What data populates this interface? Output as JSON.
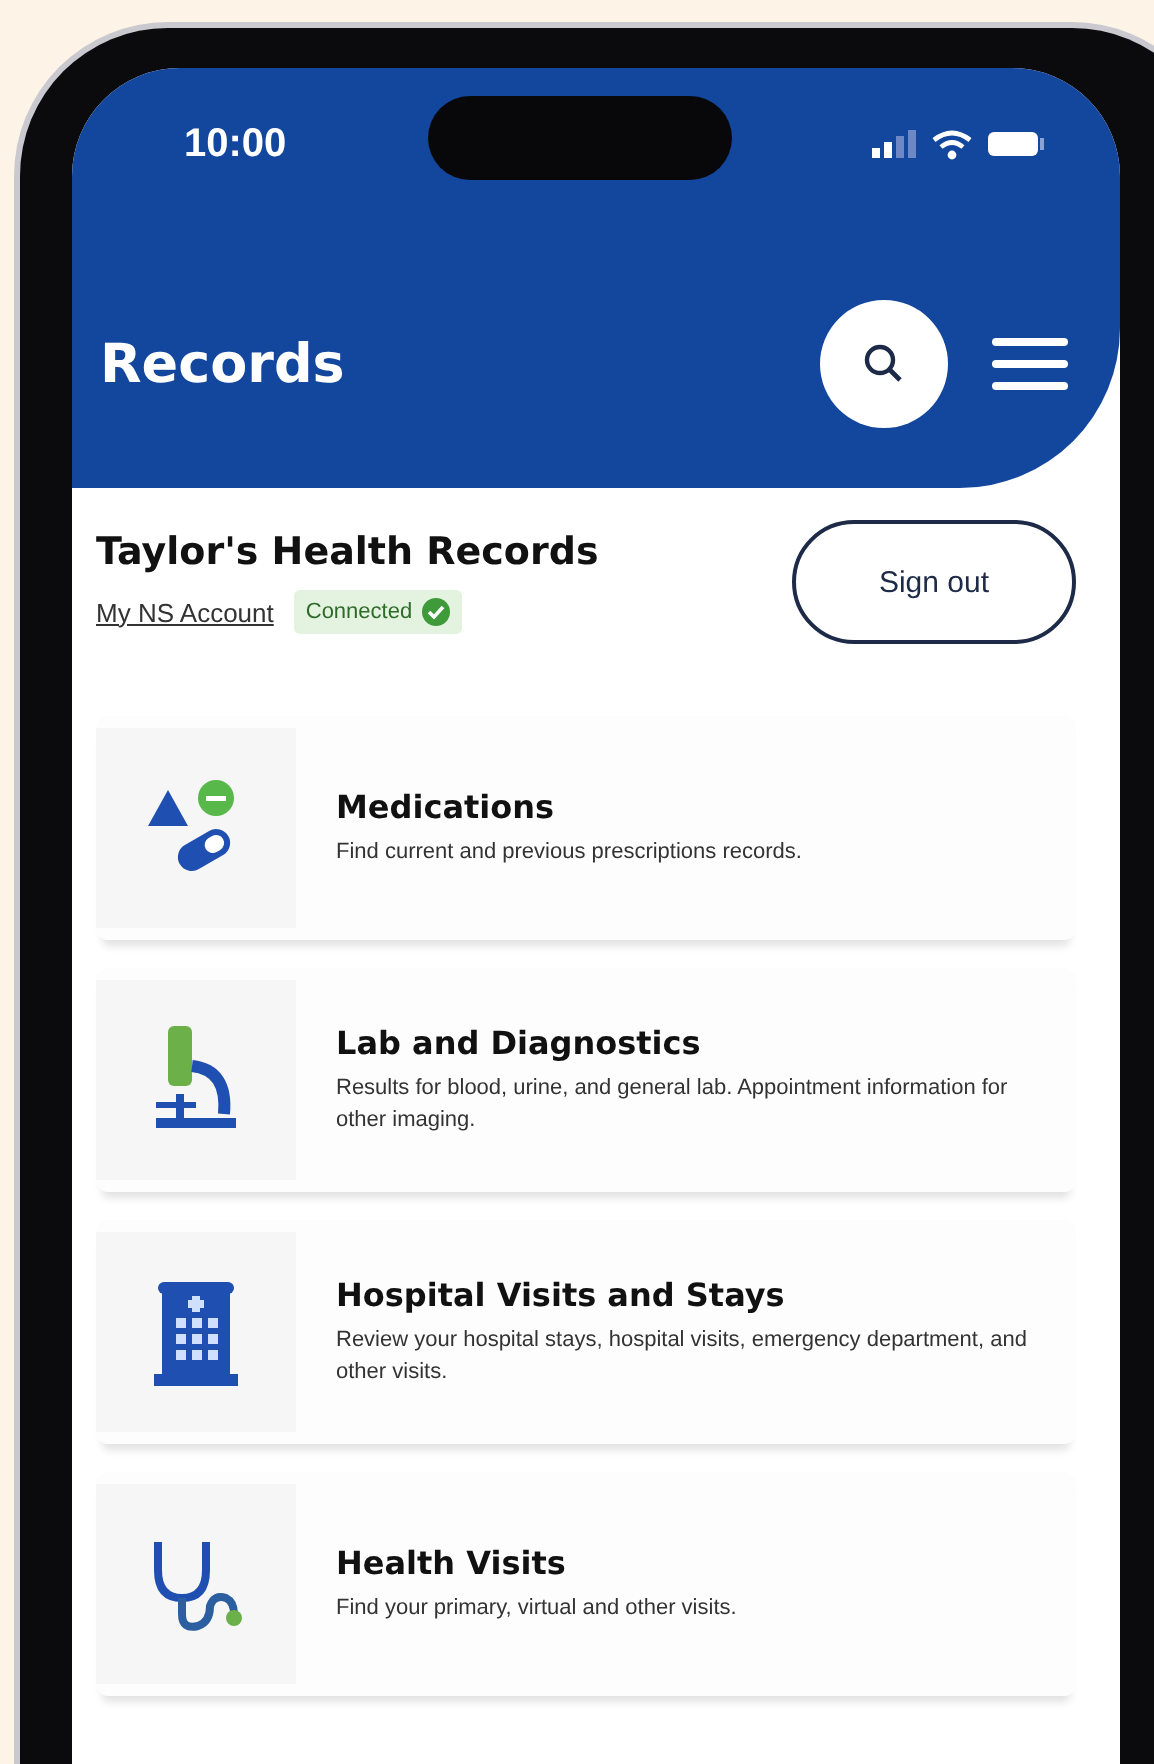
{
  "status_bar": {
    "time": "10:00"
  },
  "header": {
    "title": "Records"
  },
  "account": {
    "title": "Taylor's Health Records",
    "link": "My NS Account",
    "badge": "Connected",
    "button": "Sign out"
  },
  "records": [
    {
      "kind": "pills",
      "title": "Medications",
      "description": "Find current and previous prescriptions records."
    },
    {
      "kind": "microscope",
      "title": "Lab and Diagnostics",
      "description": "Results for blood, urine, and general lab. Appointment information for other imaging."
    },
    {
      "kind": "hospital",
      "title": "Hospital Visits and Stays",
      "description": "Review your hospital stays, hospital visits, emergency department, and other visits."
    },
    {
      "kind": "stethoscope",
      "title": "Health Visits",
      "description": "Find your primary, virtual and other visits."
    }
  ]
}
